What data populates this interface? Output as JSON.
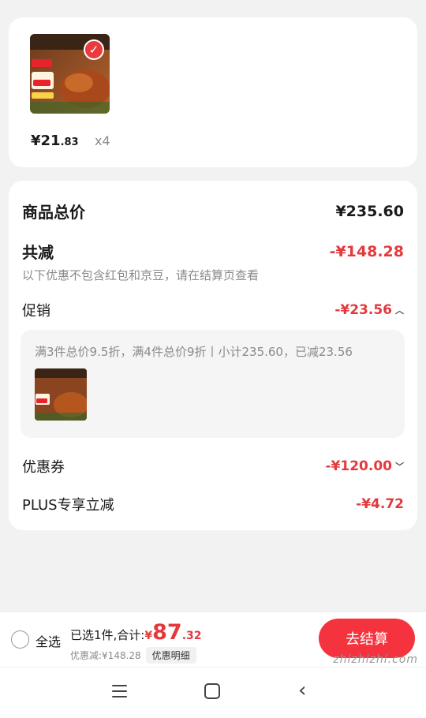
{
  "product": {
    "price_int": "¥21",
    "price_dec": ".83",
    "quantity": "x4",
    "selected": true
  },
  "summary": {
    "total_label": "商品总价",
    "total_value": "¥235.60",
    "reduction_label": "共减",
    "reduction_value": "-¥148.28",
    "reduction_note": "以下优惠不包含红包和京豆，请在结算页查看",
    "promo_label": "促销",
    "promo_value": "-¥23.56",
    "promo_desc": "满3件总价9.5折，满4件总价9折丨小计235.60，已减23.56",
    "coupon_label": "优惠券",
    "coupon_value": "-¥120.00",
    "plus_label": "PLUS专享立减",
    "plus_value": "-¥4.72"
  },
  "bottom": {
    "select_all": "全选",
    "total_prefix": "已选1件,合计:",
    "currency": "¥",
    "total_int": "87",
    "total_dec": ".32",
    "discount_text": "优惠减:¥148.28",
    "detail_label": "优惠明细",
    "checkout_label": "去结算"
  },
  "watermark": "zhizhizhi.com",
  "colors": {
    "accent_red": "#e4393c",
    "checkout_button": "#f5333f",
    "background": "#f2f2f2"
  },
  "icons": [
    "check-icon",
    "chevron-up-icon",
    "chevron-down-icon",
    "menu-icon",
    "home-icon",
    "back-icon"
  ]
}
